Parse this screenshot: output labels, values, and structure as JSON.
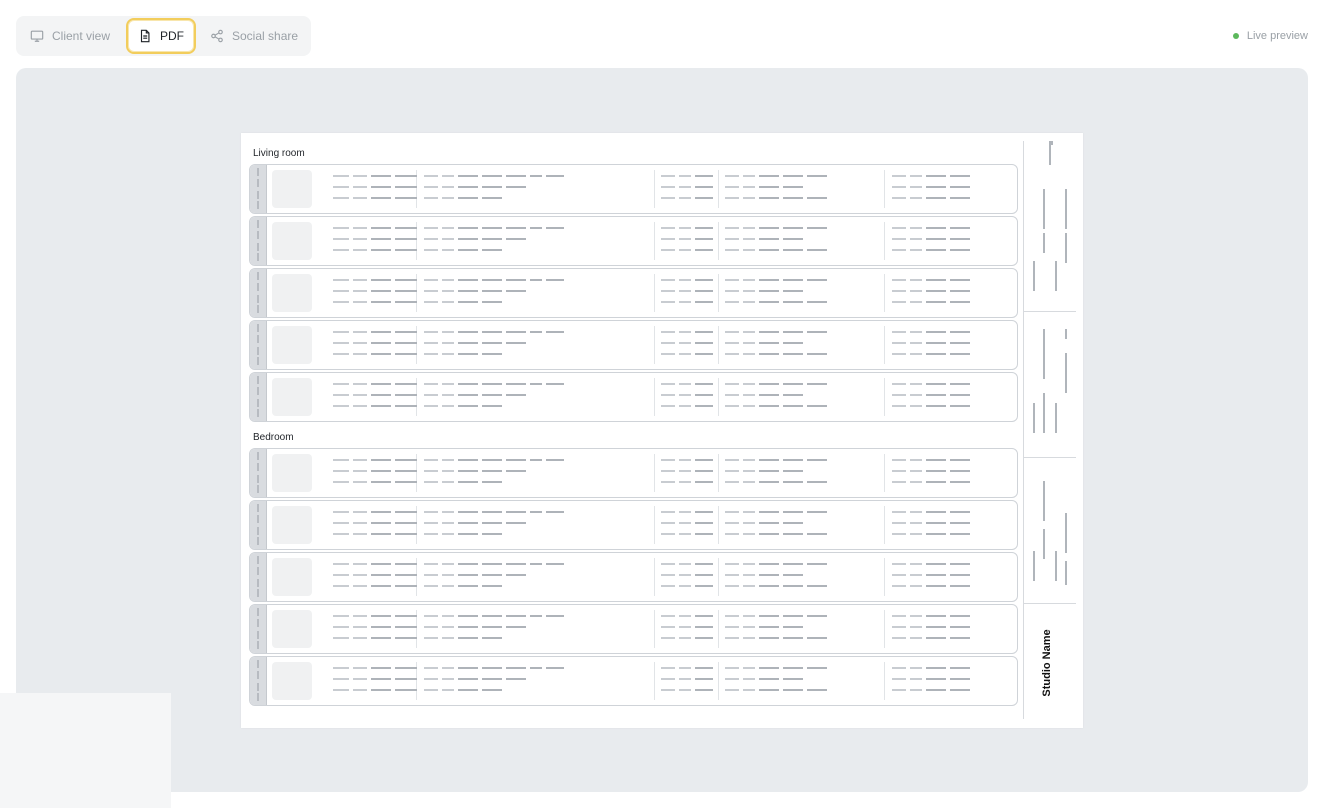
{
  "toolbar": {
    "tabs": [
      {
        "label": "Client view",
        "icon": "monitor-icon",
        "active": false
      },
      {
        "label": "PDF",
        "icon": "document-icon",
        "active": true
      },
      {
        "label": "Social share",
        "icon": "share-icon",
        "active": false
      }
    ],
    "status_label": "Live preview",
    "status_color": "#5cb85c"
  },
  "sheet": {
    "sections": [
      {
        "title": "Living room",
        "item_count": 5
      },
      {
        "title": "Bedroom",
        "item_count": 5
      }
    ],
    "studio_name": "Studio Name"
  },
  "colors": {
    "accent": "#f2cd5c",
    "stage_bg": "#e8ebee"
  }
}
